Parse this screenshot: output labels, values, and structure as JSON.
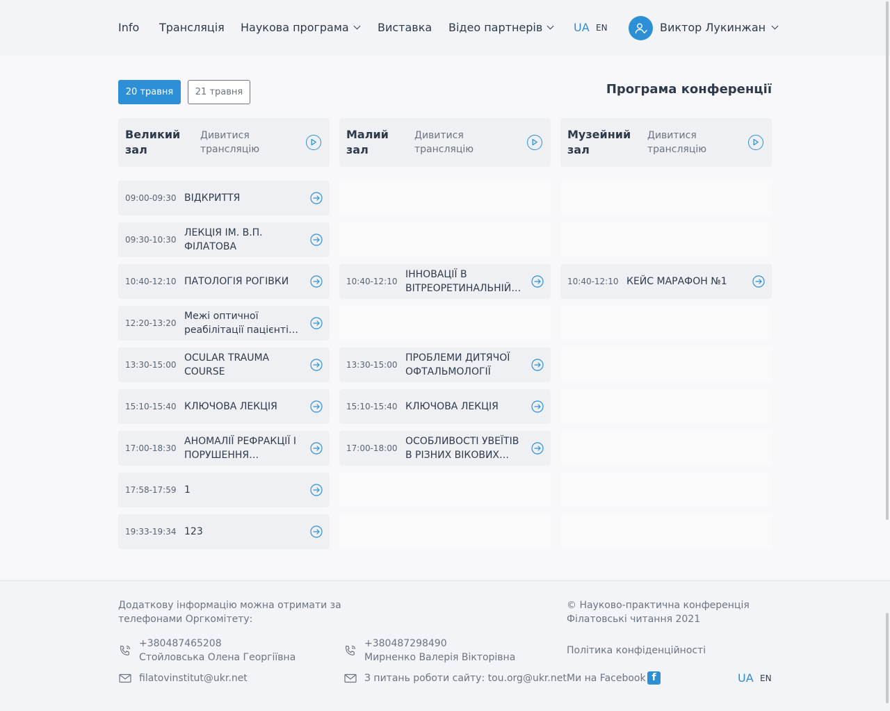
{
  "header": {
    "nav": [
      {
        "label": "Info",
        "dropdown": false
      },
      {
        "label": "Трансляція",
        "dropdown": false
      },
      {
        "label": "Наукова програма",
        "dropdown": true
      },
      {
        "label": "Виставка",
        "dropdown": false
      },
      {
        "label": "Відео партнерів",
        "dropdown": true
      }
    ],
    "lang_ua": "UA",
    "lang_en": "EN",
    "user_name": "Виктор Лукинжан"
  },
  "days": {
    "active": "20 травня",
    "inactive": "21 травня"
  },
  "page_title": "Програма конференції",
  "halls": [
    {
      "name": "Великий зал",
      "watch": "Дивитися трансляцію"
    },
    {
      "name": "Малий зал",
      "watch": "Дивитися трансляцію"
    },
    {
      "name": "Музейний зал",
      "watch": "Дивитися трансляцію"
    }
  ],
  "sessions": {
    "col0": [
      {
        "time": "09:00-09:30",
        "title": "ВІДКРИТТЯ"
      },
      {
        "time": "09:30-10:30",
        "title": "ЛЕКЦІЯ ІМ. В.П. ФІЛАТОВА"
      },
      {
        "time": "10:40-12:10",
        "title": "ПАТОЛОГІЯ РОГІВКИ"
      },
      {
        "time": "12:20-13:20",
        "title": "Межі оптичної реабілітації пацієнтів з кератоконусом"
      },
      {
        "time": "13:30-15:00",
        "title": "OCULAR TRAUMA COURSE"
      },
      {
        "time": "15:10-15:40",
        "title": "КЛЮЧОВА ЛЕКЦІЯ"
      },
      {
        "time": "17:00-18:30",
        "title": "АНОМАЛІЇ РЕФРАКЦІЇ І ПОРУШЕННЯ БІНОКУЛЯРНОГО ЗОРУ"
      },
      {
        "time": "17:58-17:59",
        "title": "1"
      },
      {
        "time": "19:33-19:34",
        "title": "123"
      }
    ],
    "col1": [
      null,
      null,
      {
        "time": "10:40-12:10",
        "title": "ІННОВАЦІЇ В ВІТРЕОРЕТИНАЛЬНІЙ ХІРУРГІЇ"
      },
      null,
      {
        "time": "13:30-15:00",
        "title": "ПРОБЛЕМИ ДИТЯЧОЇ ОФТАЛЬМОЛОГІЇ"
      },
      {
        "time": "15:10-15:40",
        "title": "КЛЮЧОВА ЛЕКЦІЯ"
      },
      {
        "time": "17:00-18:00",
        "title": "ОСОБЛИВОСТІ УВЕЇТІВ В РІЗНИХ ВІКОВИХ ГРУПАХ"
      },
      null,
      null
    ],
    "col2": [
      null,
      null,
      {
        "time": "10:40-12:10",
        "title": "КЕЙС МАРАФОН №1"
      },
      null,
      null,
      null,
      null,
      null,
      null
    ]
  },
  "footer": {
    "info_line1": "Додаткову інформацію можна отримати за",
    "info_line2": "телефонами Оргкомітету:",
    "contact1_phone": "+380487465208",
    "contact1_name": "Стойловська Олена Георгіївна",
    "email1": "filatovinstitut@ukr.net",
    "contact2_phone": "+380487298490",
    "contact2_name": "Мирненко Валерія Вікторівна",
    "email2": "З питань роботи сайту: tou.org@ukr.net",
    "copyright_line1": "© Науково-практична конференція",
    "copyright_line2": "Філатовські читання 2021",
    "privacy": "Політика конфіденційності",
    "facebook": "Ми на Facebook",
    "fb_letter": "f",
    "lang_ua": "UA",
    "lang_en": "EN"
  }
}
